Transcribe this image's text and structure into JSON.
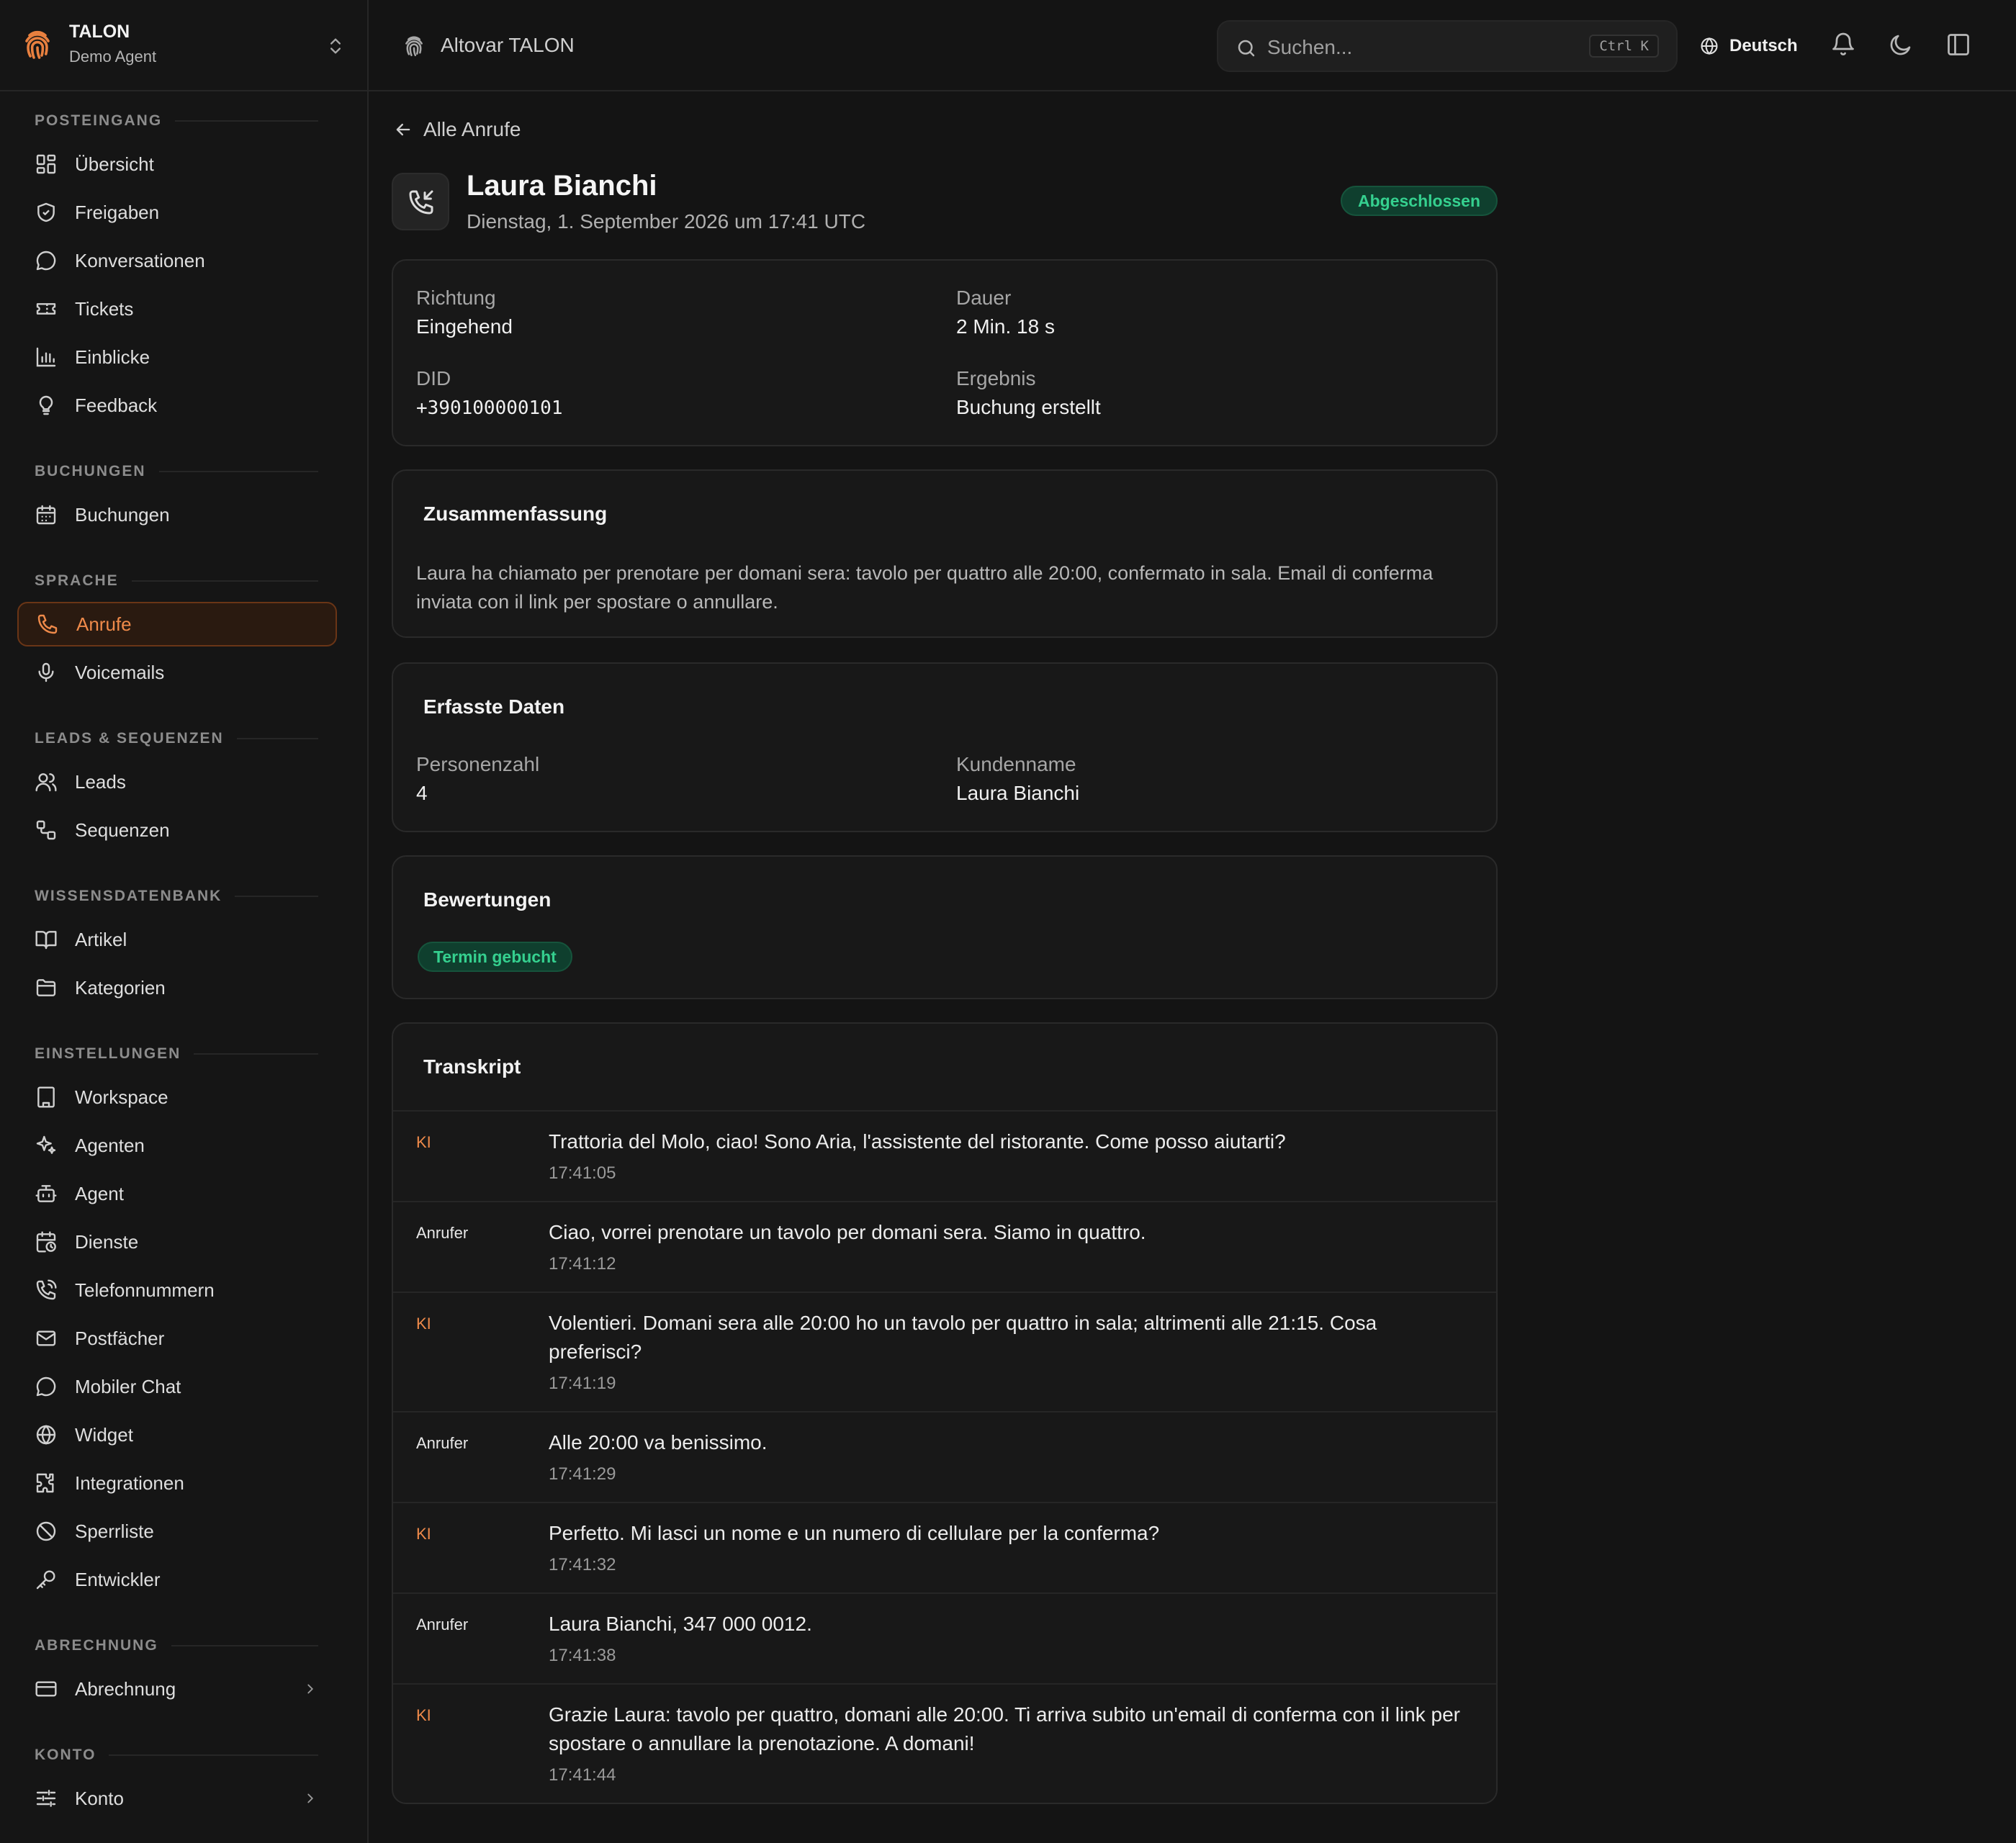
{
  "sidebar": {
    "brand": {
      "name": "TALON",
      "subtitle": "Demo Agent"
    },
    "sections": [
      {
        "label": "POSTEINGANG",
        "items": [
          {
            "label": "Übersicht",
            "icon": "dashboard-icon"
          },
          {
            "label": "Freigaben",
            "icon": "shield-check-icon"
          },
          {
            "label": "Konversationen",
            "icon": "chat-bubble-icon"
          },
          {
            "label": "Tickets",
            "icon": "ticket-icon"
          },
          {
            "label": "Einblicke",
            "icon": "bar-chart-icon"
          },
          {
            "label": "Feedback",
            "icon": "lightbulb-icon"
          }
        ]
      },
      {
        "label": "BUCHUNGEN",
        "items": [
          {
            "label": "Buchungen",
            "icon": "calendar-icon"
          }
        ]
      },
      {
        "label": "SPRACHE",
        "items": [
          {
            "label": "Anrufe",
            "icon": "phone-icon",
            "active": true
          },
          {
            "label": "Voicemails",
            "icon": "microphone-icon"
          }
        ]
      },
      {
        "label": "LEADS & SEQUENZEN",
        "items": [
          {
            "label": "Leads",
            "icon": "users-icon"
          },
          {
            "label": "Sequenzen",
            "icon": "workflow-icon"
          }
        ]
      },
      {
        "label": "WISSENSDATENBANK",
        "items": [
          {
            "label": "Artikel",
            "icon": "book-icon"
          },
          {
            "label": "Kategorien",
            "icon": "folder-icon"
          }
        ]
      },
      {
        "label": "EINSTELLUNGEN",
        "items": [
          {
            "label": "Workspace",
            "icon": "building-icon"
          },
          {
            "label": "Agenten",
            "icon": "sparkles-icon"
          },
          {
            "label": "Agent",
            "icon": "bot-icon"
          },
          {
            "label": "Dienste",
            "icon": "calendar-clock-icon"
          },
          {
            "label": "Telefonnummern",
            "icon": "phone-call-icon"
          },
          {
            "label": "Postfächer",
            "icon": "mail-icon"
          },
          {
            "label": "Mobiler Chat",
            "icon": "chat-bubble-icon"
          },
          {
            "label": "Widget",
            "icon": "globe-icon"
          },
          {
            "label": "Integrationen",
            "icon": "puzzle-icon"
          },
          {
            "label": "Sperrliste",
            "icon": "ban-icon"
          },
          {
            "label": "Entwickler",
            "icon": "key-icon"
          }
        ]
      },
      {
        "label": "ABRECHNUNG",
        "items": [
          {
            "label": "Abrechnung",
            "icon": "credit-card-icon",
            "expandable": true
          }
        ]
      },
      {
        "label": "KONTO",
        "items": [
          {
            "label": "Konto",
            "icon": "sliders-icon",
            "expandable": true
          }
        ]
      }
    ]
  },
  "topbar": {
    "title": "Altovar TALON",
    "search": {
      "placeholder": "Suchen...",
      "shortcut": "Ctrl K"
    },
    "language": "Deutsch"
  },
  "call": {
    "back_label": "Alle Anrufe",
    "name": "Laura Bianchi",
    "date": "Dienstag, 1. September 2026 um 17:41 UTC",
    "status": "Abgeschlossen",
    "details": {
      "direction_label": "Richtung",
      "direction": "Eingehend",
      "duration_label": "Dauer",
      "duration": "2 Min. 18 s",
      "did_label": "DID",
      "did": "+390100000101",
      "result_label": "Ergebnis",
      "result": "Buchung erstellt"
    },
    "summary": {
      "title": "Zusammenfassung",
      "text": "Laura ha chiamato per prenotare per domani sera: tavolo per quattro alle 20:00, confermato in sala. Email di conferma inviata con il link per spostare o annullare."
    },
    "captured": {
      "title": "Erfasste Daten",
      "party_label": "Personenzahl",
      "party": "4",
      "customer_label": "Kundenname",
      "customer": "Laura Bianchi"
    },
    "ratings": {
      "title": "Bewertungen",
      "tag": "Termin gebucht"
    },
    "transcript": {
      "title": "Transkript",
      "entries": [
        {
          "speaker": "KI",
          "text": "Trattoria del Molo, ciao! Sono Aria, l'assistente del ristorante. Come posso aiutarti?",
          "time": "17:41:05"
        },
        {
          "speaker": "Anrufer",
          "text": "Ciao, vorrei prenotare un tavolo per domani sera. Siamo in quattro.",
          "time": "17:41:12"
        },
        {
          "speaker": "KI",
          "text": "Volentieri. Domani sera alle 20:00 ho un tavolo per quattro in sala; altrimenti alle 21:15. Cosa preferisci?",
          "time": "17:41:19"
        },
        {
          "speaker": "Anrufer",
          "text": "Alle 20:00 va benissimo.",
          "time": "17:41:29"
        },
        {
          "speaker": "KI",
          "text": "Perfetto. Mi lasci un nome e un numero di cellulare per la conferma?",
          "time": "17:41:32"
        },
        {
          "speaker": "Anrufer",
          "text": "Laura Bianchi, 347 000 0012.",
          "time": "17:41:38"
        },
        {
          "speaker": "KI",
          "text": "Grazie Laura: tavolo per quattro, domani alle 20:00. Ti arriva subito un'email di conferma con il link per spostare o annullare la prenotazione. A domani!",
          "time": "17:41:44"
        }
      ]
    }
  },
  "colors": {
    "accent": "#ef8a4a",
    "success": "#35d08f",
    "background": "#141414",
    "surface": "#181818"
  }
}
